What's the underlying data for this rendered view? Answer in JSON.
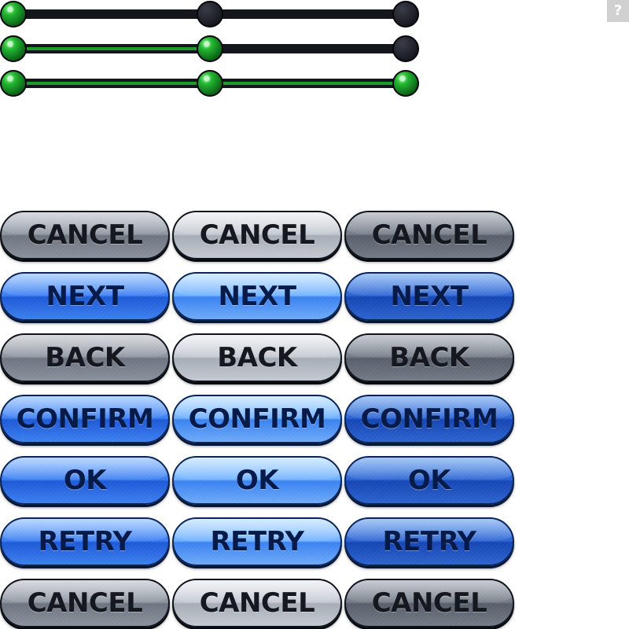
{
  "progress_tracks": [
    {
      "steps": 3,
      "completed": 1
    },
    {
      "steps": 3,
      "completed": 2
    },
    {
      "steps": 3,
      "completed": 3
    }
  ],
  "help_badge": {
    "label": "?"
  },
  "button_rows": [
    {
      "label": "CANCEL",
      "style": "gray"
    },
    {
      "label": "NEXT",
      "style": "blue"
    },
    {
      "label": "BACK",
      "style": "gray"
    },
    {
      "label": "CONFIRM",
      "style": "blue"
    },
    {
      "label": "OK",
      "style": "blue"
    },
    {
      "label": "RETRY",
      "style": "blue"
    },
    {
      "label": "CANCEL",
      "style": "gray"
    }
  ],
  "button_states": [
    "normal",
    "hover",
    "pressed"
  ],
  "colors": {
    "track_dark": "#14161c",
    "track_green": "#1f9a2c",
    "node_green": "#22b532",
    "node_dark": "#15171e",
    "button_gray": "#8d949e",
    "button_blue": "#2f6fe8",
    "label_dark": "#15191f"
  }
}
